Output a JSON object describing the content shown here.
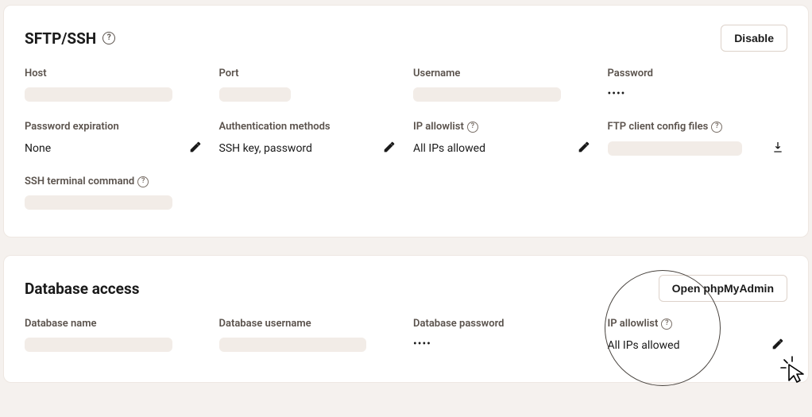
{
  "sftp": {
    "title": "SFTP/SSH",
    "disable": "Disable",
    "fields": {
      "host": "Host",
      "port": "Port",
      "username": "Username",
      "password": "Password",
      "password_value": "••••",
      "password_exp": "Password expiration",
      "password_exp_value": "None",
      "auth_methods": "Authentication methods",
      "auth_methods_value": "SSH key, password",
      "ip_allowlist": "IP allowlist",
      "ip_allowlist_value": "All IPs allowed",
      "ftp_config": "FTP client config files",
      "ssh_cmd": "SSH terminal command"
    }
  },
  "db": {
    "title": "Database access",
    "open_btn": "Open phpMyAdmin",
    "fields": {
      "name": "Database name",
      "username": "Database username",
      "password": "Database password",
      "password_value": "••••",
      "ip_allowlist": "IP allowlist",
      "ip_allowlist_value": "All IPs allowed"
    }
  }
}
